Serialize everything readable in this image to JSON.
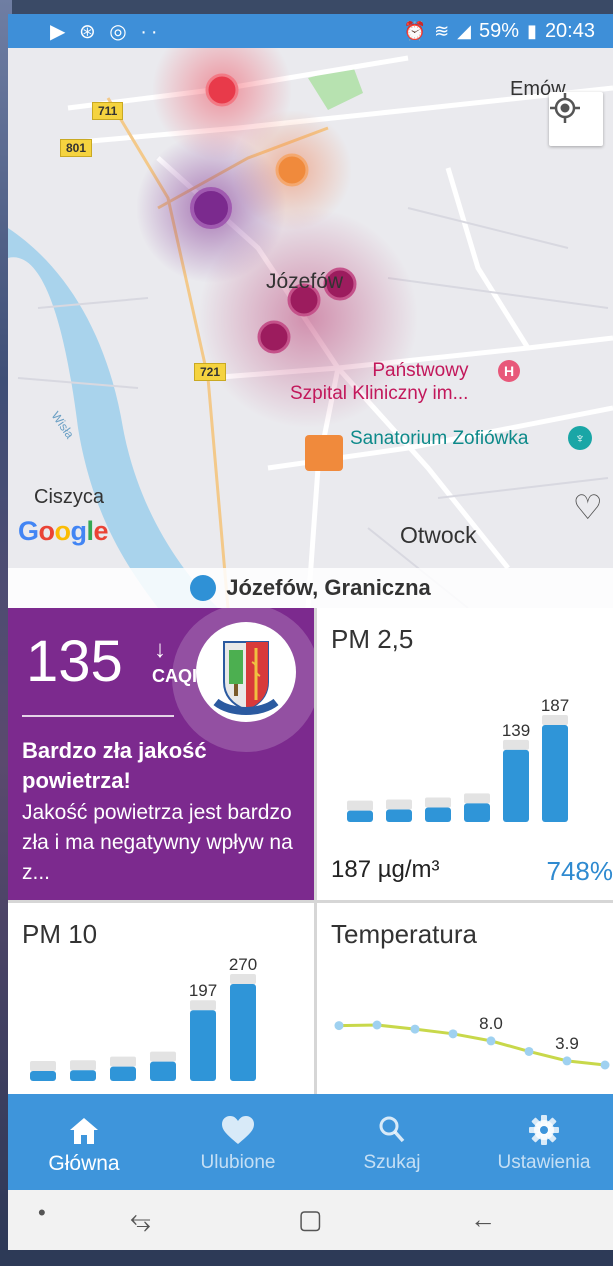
{
  "status_bar": {
    "left_icons": "▶ ⊛ ◎ ··",
    "battery": "59%",
    "time": "20:43"
  },
  "map": {
    "labels": {
      "emow": "Emów",
      "jozefow": "Józefów",
      "hospital": "Państwowy\nSzpital Kliniczny im...",
      "sanatorium": "Sanatorium Zofiówka",
      "ciszyca": "Ciszyca",
      "otwock": "Otwock",
      "wisla": "Wisła"
    },
    "road_numbers": [
      "711",
      "801",
      "721"
    ],
    "google": "Google",
    "location_name": "Józefów, Graniczna",
    "colors": {
      "red": "#e83a4a",
      "orange": "#f08a3c",
      "purple": "#7b2a8e",
      "magenta": "#b2205e"
    }
  },
  "caqi_card": {
    "value": "135",
    "trend_icon": "arrow-down",
    "unit": "CAQI",
    "headline": "Bardzo zła jakość powietrza!",
    "description": "Jakość powietrza jest bardzo zła i ma negatywny wpływ na z...",
    "color": "#7c2a8e"
  },
  "pm25_card": {
    "title": "PM 2,5",
    "bars": [
      22,
      24,
      28,
      36,
      139,
      187
    ],
    "labels": [
      "",
      "",
      "",
      "",
      "139",
      "187"
    ],
    "current_value": "187 µg/m³",
    "percent": "748%",
    "bar_color": "#2f95d8"
  },
  "pm10_card": {
    "title": "PM 10",
    "bars": [
      24,
      30,
      40,
      54,
      197,
      270
    ],
    "labels": [
      "",
      "",
      "",
      "",
      "197",
      "270"
    ]
  },
  "temp_card": {
    "title": "Temperatura",
    "points": [
      10.6,
      10.7,
      10.0,
      9.2,
      8.0,
      6.2,
      4.6,
      3.9
    ],
    "labels": {
      "4": "8.0",
      "6": "3.9"
    },
    "line_color": "#c8d84a",
    "point_color": "#9fd1f0"
  },
  "bottom_nav": {
    "items": [
      {
        "label": "Główna",
        "icon": "home-icon",
        "active": true
      },
      {
        "label": "Ulubione",
        "icon": "heart-icon",
        "active": false
      },
      {
        "label": "Szukaj",
        "icon": "search-icon",
        "active": false
      },
      {
        "label": "Ustawienia",
        "icon": "gear-icon",
        "active": false
      }
    ]
  }
}
